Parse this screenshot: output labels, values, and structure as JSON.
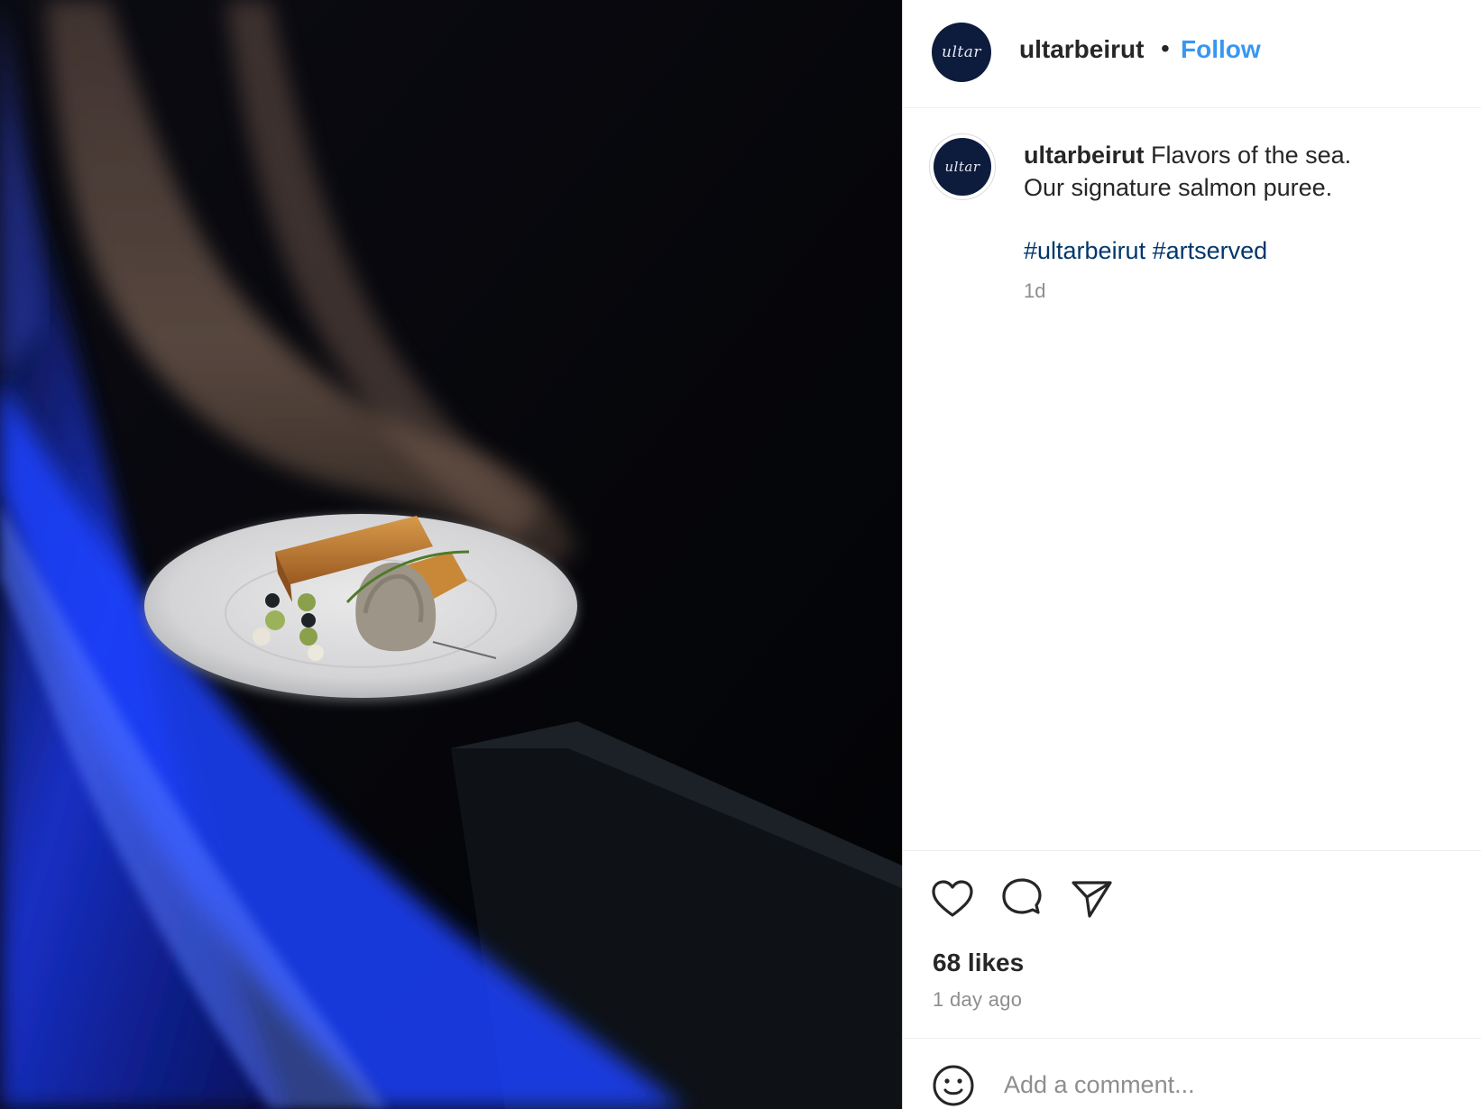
{
  "post": {
    "username": "ultarbeirut",
    "avatar_mark": "ultar",
    "separator": "•",
    "follow_label": "Follow",
    "caption_user": "ultarbeirut",
    "caption_line1": "Flavors of the sea.",
    "caption_line2": "Our signature salmon puree.",
    "hashtags": [
      "#ultarbeirut",
      "#artserved"
    ],
    "time_short": "1d",
    "likes": "68 likes",
    "time_long": "1 day ago",
    "comment_placeholder": "Add a comment..."
  },
  "icons": {
    "like": "heart-icon",
    "comment": "comment-bubble-icon",
    "share": "paper-plane-icon",
    "emoji": "smiley-icon"
  },
  "colors": {
    "accent": "#3897f0",
    "hashtag": "#00376b",
    "avatar_bg": "#0d1b3d",
    "muted": "#8e8e8e"
  }
}
